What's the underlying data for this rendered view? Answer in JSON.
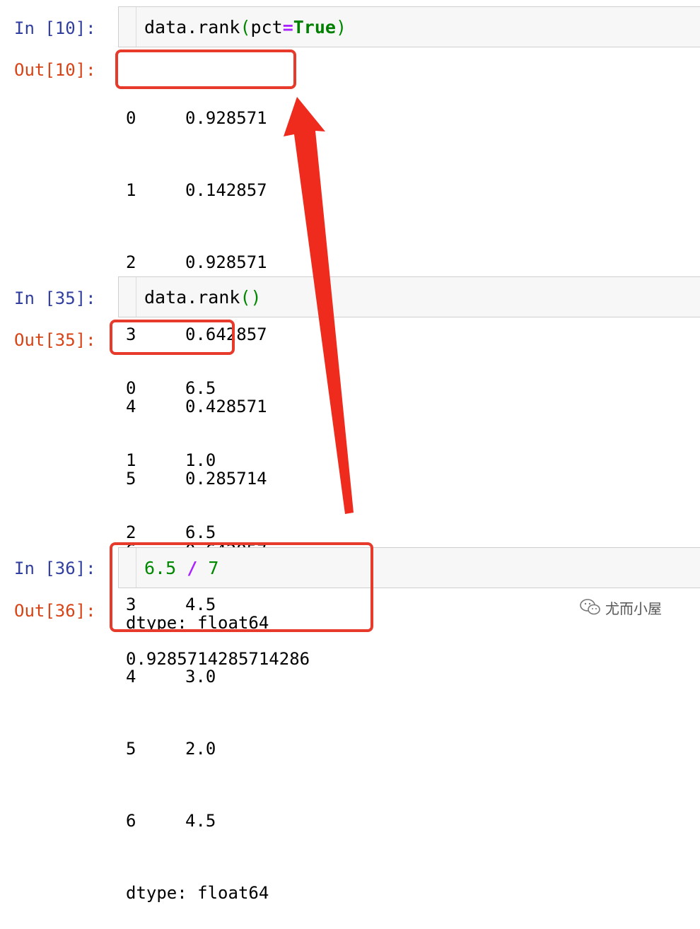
{
  "cells": [
    {
      "in_prompt": "In [10]:",
      "code": {
        "pre": "data.rank",
        "open": "(",
        "arg": "pct",
        "eq": "=",
        "kw": "True",
        "close": ")"
      },
      "out_prompt": "Out[10]:",
      "output": {
        "rows": [
          {
            "index": "0",
            "value": "0.928571"
          },
          {
            "index": "1",
            "value": "0.142857"
          },
          {
            "index": "2",
            "value": "0.928571"
          },
          {
            "index": "3",
            "value": "0.642857"
          },
          {
            "index": "4",
            "value": "0.428571"
          },
          {
            "index": "5",
            "value": "0.285714"
          },
          {
            "index": "6",
            "value": "0.642857"
          }
        ],
        "dtype": "dtype: float64"
      }
    },
    {
      "in_prompt": "In [35]:",
      "code": {
        "pre": "data.rank",
        "open": "(",
        "close": ")"
      },
      "out_prompt": "Out[35]:",
      "output": {
        "rows": [
          {
            "index": "0",
            "value": "6.5"
          },
          {
            "index": "1",
            "value": "1.0"
          },
          {
            "index": "2",
            "value": "6.5"
          },
          {
            "index": "3",
            "value": "4.5"
          },
          {
            "index": "4",
            "value": "3.0"
          },
          {
            "index": "5",
            "value": "2.0"
          },
          {
            "index": "6",
            "value": "4.5"
          }
        ],
        "dtype": "dtype: float64"
      }
    },
    {
      "in_prompt": "In [36]:",
      "code": {
        "a": "6.5",
        "op": "/",
        "b": "7"
      },
      "out_prompt": "Out[36]:",
      "output": {
        "text": "0.9285714285714286"
      }
    }
  ],
  "annotations": {
    "box_color": "#e83a2a",
    "arrow_color": "#ee2b1c"
  },
  "watermark": {
    "text": "尤而小屋",
    "icon": "wechat-icon"
  }
}
